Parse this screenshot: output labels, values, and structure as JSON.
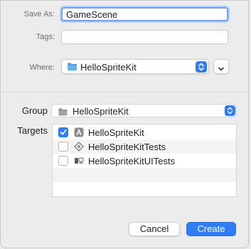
{
  "form": {
    "save_as_label": "Save As:",
    "save_as_value": "GameScene",
    "tags_label": "Tags:",
    "tags_value": "",
    "where_label": "Where:",
    "where_value": "HelloSpriteKit"
  },
  "group": {
    "label": "Group",
    "value": "HelloSpriteKit"
  },
  "targets": {
    "label": "Targets",
    "items": [
      {
        "name": "HelloSpriteKit",
        "checked": true,
        "icon": "app-target-icon"
      },
      {
        "name": "HelloSpriteKitTests",
        "checked": false,
        "icon": "unit-test-target-icon"
      },
      {
        "name": "HelloSpriteKitUITests",
        "checked": false,
        "icon": "ui-test-target-icon"
      }
    ]
  },
  "buttons": {
    "cancel": "Cancel",
    "create": "Create"
  },
  "colors": {
    "accent": "#2f7cf6",
    "folder": "#4a9fe8"
  }
}
